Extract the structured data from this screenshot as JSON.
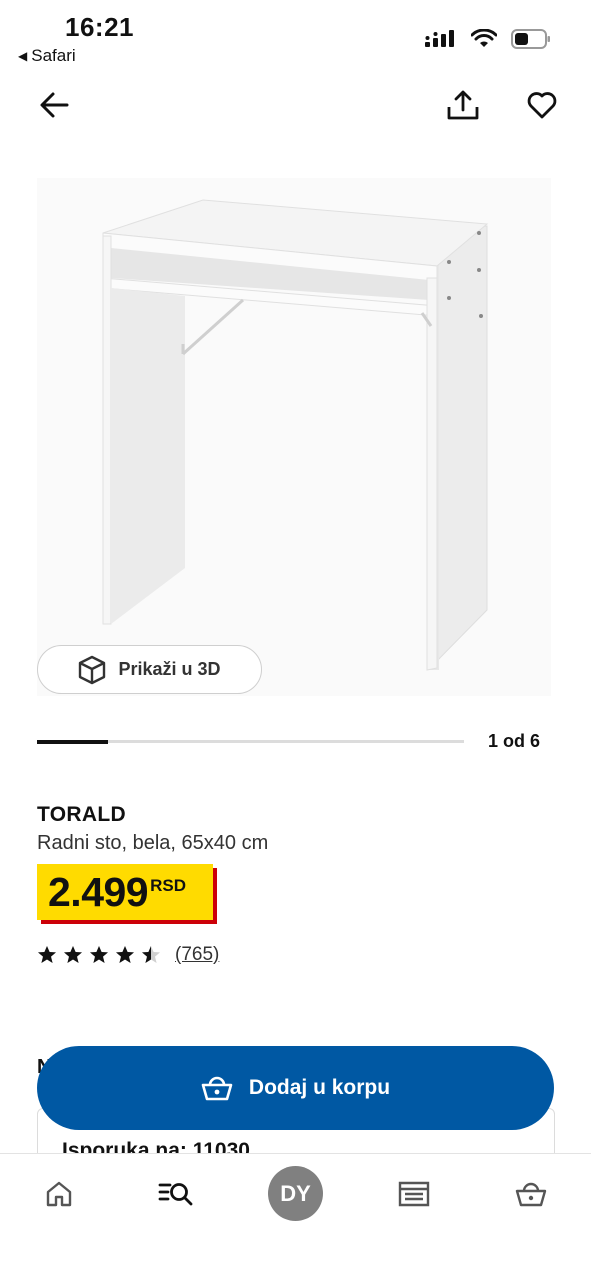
{
  "status_bar": {
    "time": "16:21",
    "back_app": "Safari"
  },
  "product": {
    "view_3d_label": "Prikaži u 3D",
    "gallery_position": "1 od 6",
    "gallery_progress": 0.166,
    "name": "TORALD",
    "description": "Radni sto, bela, 65x40 cm",
    "price_value": "2.499",
    "price_currency": "RSD",
    "rating": 4.5,
    "review_count": "(765)"
  },
  "add_to_cart_label": "Dodaj u korpu",
  "delivery": {
    "hidden_heading_initial": "N",
    "label": "Isporuka na: 11030"
  },
  "tab_bar": {
    "avatar_initials": "DY",
    "items": [
      "home-icon",
      "search-icon",
      "avatar",
      "store-icon",
      "cart-icon"
    ]
  },
  "colors": {
    "accent_blue": "#0058a3",
    "price_yellow": "#ffdb00",
    "price_shadow_red": "#cc0008",
    "avatar_gray": "#808080"
  }
}
